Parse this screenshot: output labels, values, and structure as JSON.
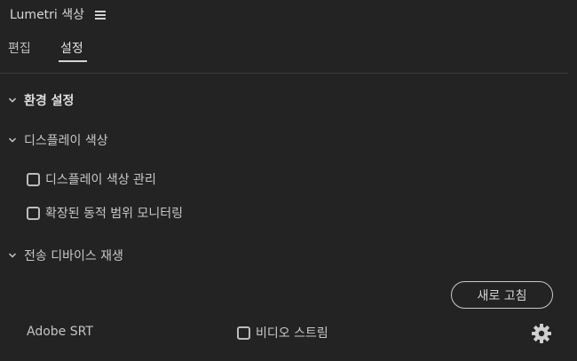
{
  "panel": {
    "title": "Lumetri 색상",
    "menu_icon": "hamburger-menu-icon"
  },
  "tabs": [
    {
      "label": "편집",
      "active": false
    },
    {
      "label": "설정",
      "active": true
    }
  ],
  "sections": {
    "environment": {
      "label": "환경 설정",
      "expanded": true
    },
    "display_color": {
      "label": "디스플레이 색상",
      "expanded": true,
      "options": [
        {
          "label": "디스플레이 색상 관리",
          "checked": false
        },
        {
          "label": "확장된 동적 범위 모니터링",
          "checked": false
        }
      ]
    },
    "transmit_playback": {
      "label": "전송 디바이스 재생",
      "expanded": true,
      "refresh_label": "새로 고침",
      "device_name": "Adobe SRT",
      "video_stream": {
        "label": "비디오 스트림",
        "checked": false
      },
      "settings_icon": "gear-icon"
    }
  },
  "colors": {
    "background": "#232323",
    "text": "#c8c8c8",
    "heading": "#dedede",
    "divider": "#3a3a3a"
  }
}
